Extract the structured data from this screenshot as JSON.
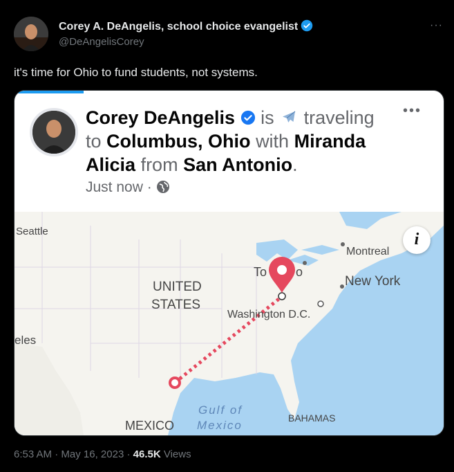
{
  "tweet": {
    "author_name": "Corey A. DeAngelis, school choice evangelist",
    "handle": "@DeAngelisCorey",
    "text": "it's time for Ohio to fund students, not systems.",
    "more_label": "···",
    "time": "6:53 AM",
    "date": "May 16, 2023",
    "views_count": "46.5K",
    "views_label": "Views"
  },
  "card": {
    "name": "Corey DeAngelis",
    "is": "is",
    "traveling": "traveling",
    "to": "to",
    "destination": "Columbus, Ohio",
    "with": "with",
    "companion": "Miranda Alicia",
    "from": "from",
    "origin": "San Antonio",
    "period": ".",
    "timestamp": "Just now",
    "sep": "·",
    "more_label": "•••"
  },
  "map": {
    "labels": {
      "seattle": "Seattle",
      "montreal": "Montreal",
      "new_york": "New York",
      "toronto_a": "To",
      "toronto_b": "o",
      "united": "UNITED",
      "states": "STATES",
      "washington": "Washington D.C.",
      "angeles": "eles",
      "gulf": "Gulf of",
      "mexico_gulf": "Mexico",
      "mexico": "MEXICO",
      "bahamas": "BAHAMAS"
    },
    "info_label": "i",
    "colors": {
      "water": "#a9d3f2",
      "land": "#f5f4ef",
      "route": "#e5485e"
    }
  }
}
